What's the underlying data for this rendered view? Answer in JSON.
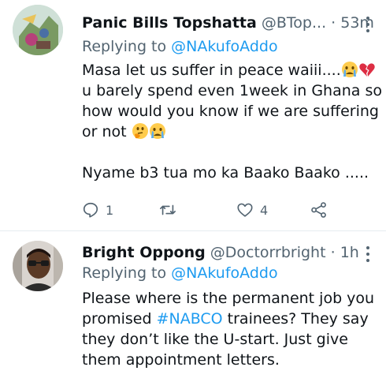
{
  "tweets": [
    {
      "name": "Panic Bills Topshatta",
      "handle": "@BTop...",
      "separator": "·",
      "time": "53m",
      "replying_prefix": "Replying to",
      "replying_to": "@NAkufoAddo",
      "lines": [
        "Masa let us suffer in peace waiii....",
        "u barely spend even 1week in Ghana so",
        "how would you know if we are suffering",
        "or not",
        "",
        "Nyame b3 tua mo ka Baako Baako ....."
      ],
      "emoji": {
        "line1": [
          "crying-face-emoji",
          "broken-heart-emoji"
        ],
        "line4": [
          "thinking-face-emoji",
          "crying-face-emoji"
        ]
      },
      "actions": {
        "reply_count": "1",
        "retweet_count": "",
        "like_count": "4"
      }
    },
    {
      "name": "Bright Oppong",
      "handle": "@Doctorrbright",
      "separator": "·",
      "time": "1h",
      "replying_prefix": "Replying to",
      "replying_to": "@NAkufoAddo",
      "lines_pre": "Please where is the permanent job you",
      "line2_pre": "promised ",
      "hashtag": "#NABCO",
      "line2_post": " trainees? They say",
      "line3": "they don’t like the U-start. Just give",
      "line4": "them appointment letters."
    }
  ],
  "colors": {
    "text": "#0f1419",
    "muted": "#536471",
    "link": "#1d9bf0",
    "divider": "#e6ecf0"
  },
  "icons": [
    "more-icon",
    "reply-icon",
    "retweet-icon",
    "like-icon",
    "share-icon"
  ]
}
